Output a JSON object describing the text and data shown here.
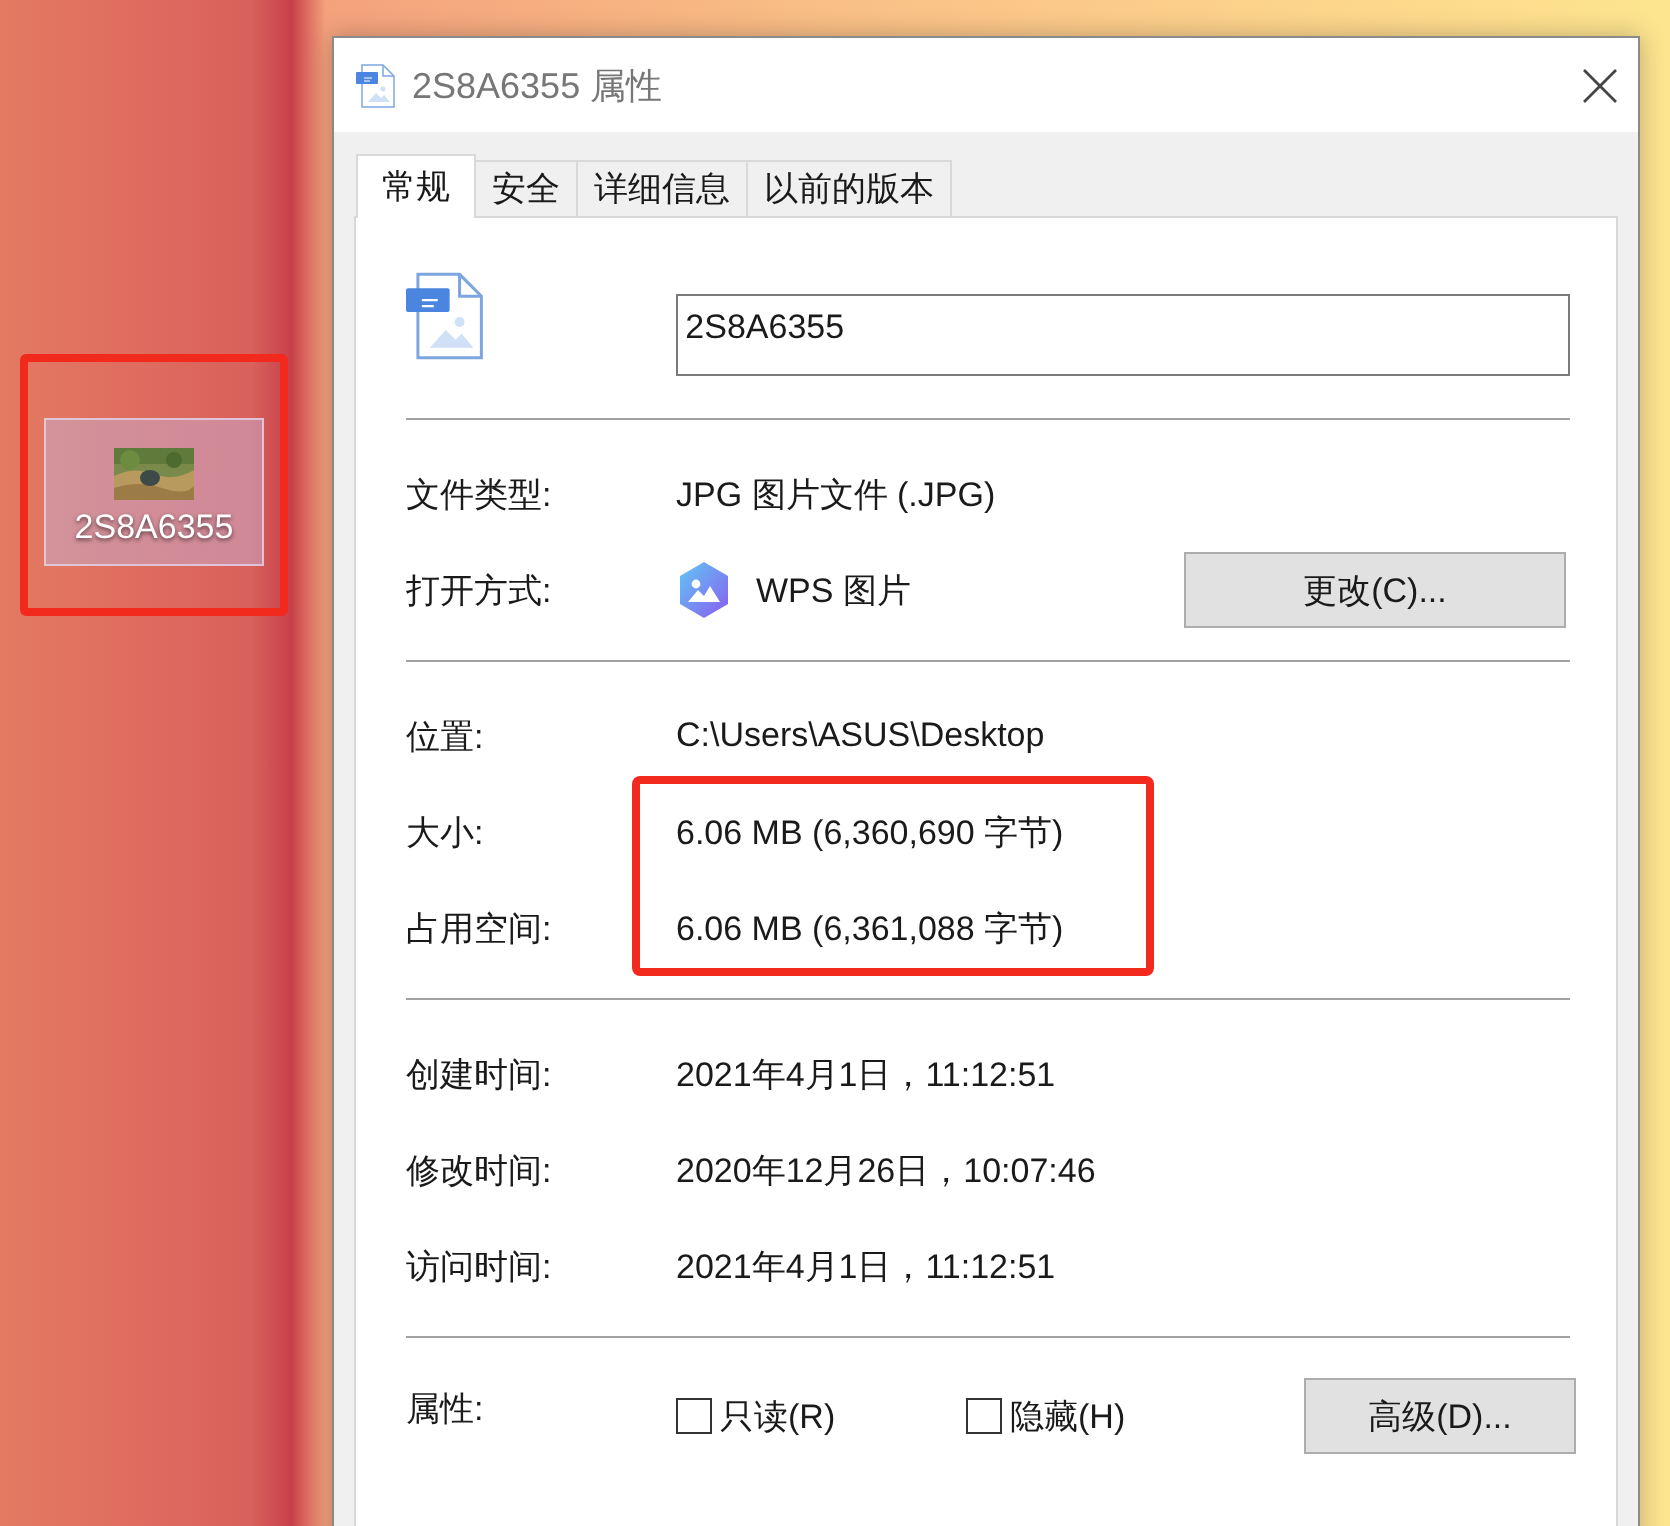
{
  "desktop_icon": {
    "label": "2S8A6355",
    "selected": true,
    "highlighted": true
  },
  "dialog": {
    "title": "2S8A6355 属性",
    "tabs": [
      {
        "label": "常规",
        "selected": true
      },
      {
        "label": "安全",
        "selected": false
      },
      {
        "label": "详细信息",
        "selected": false
      },
      {
        "label": "以前的版本",
        "selected": false
      }
    ],
    "file_name": "2S8A6355",
    "sections": [
      [
        {
          "kind": "text",
          "label": "文件类型:",
          "value": "JPG 图片文件 (.JPG)",
          "highlighted": false
        },
        {
          "kind": "app",
          "label": "打开方式:",
          "value": "WPS 图片",
          "button": "更改(C)...",
          "highlighted": false
        }
      ],
      [
        {
          "kind": "text",
          "label": "位置:",
          "value": "C:\\Users\\ASUS\\Desktop",
          "highlighted": false
        },
        {
          "kind": "text",
          "label": "大小:",
          "value": "6.06 MB (6,360,690 字节)",
          "highlighted": true
        },
        {
          "kind": "text",
          "label": "占用空间:",
          "value": "6.06 MB (6,361,088 字节)",
          "highlighted": true
        }
      ],
      [
        {
          "kind": "text",
          "label": "创建时间:",
          "value": "2021年4月1日，11:12:51",
          "highlighted": false
        },
        {
          "kind": "text",
          "label": "修改时间:",
          "value": "2020年12月26日，10:07:46",
          "highlighted": false
        },
        {
          "kind": "text",
          "label": "访问时间:",
          "value": "2021年4月1日，11:12:51",
          "highlighted": false
        }
      ]
    ],
    "attributes": {
      "label": "属性:",
      "options": [
        {
          "label": "只读(R)",
          "checked": false
        },
        {
          "label": "隐藏(H)",
          "checked": false
        }
      ],
      "button": "高级(D)..."
    }
  }
}
